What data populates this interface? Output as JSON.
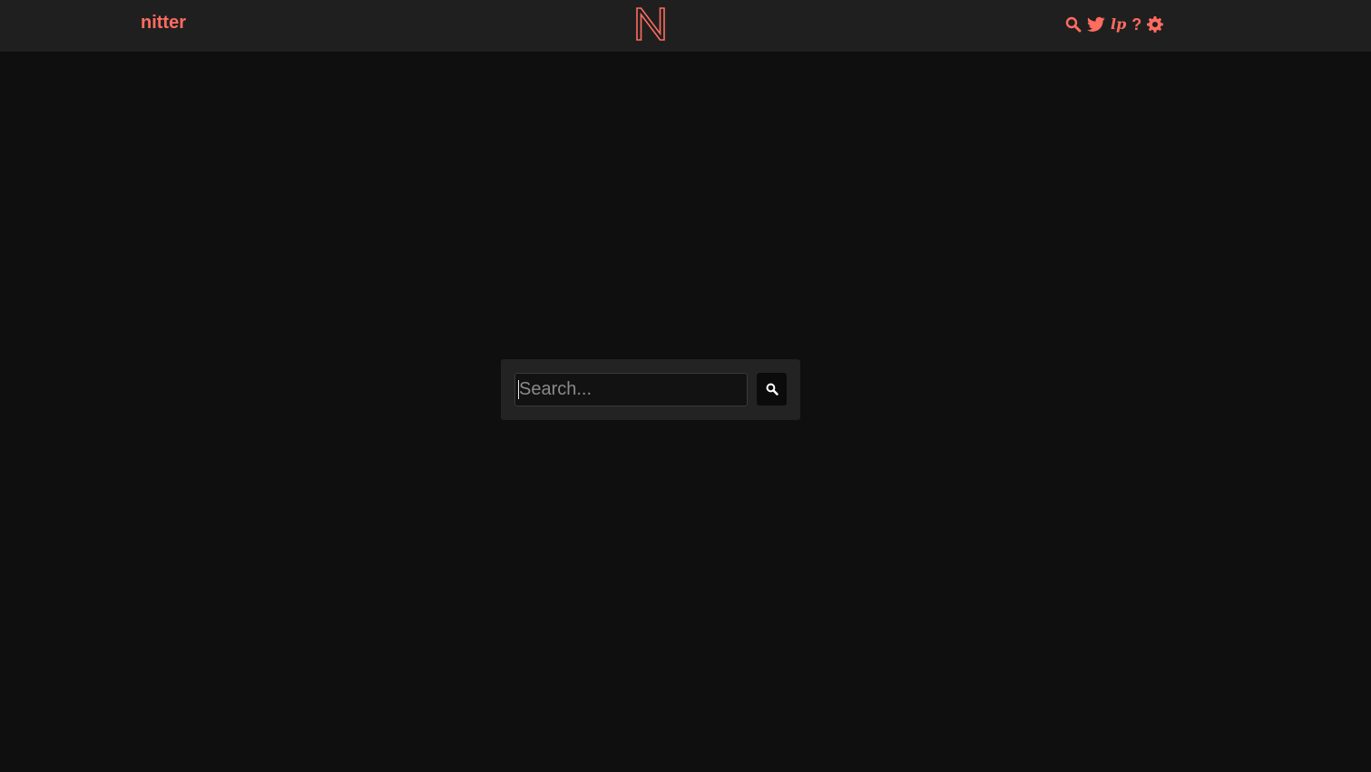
{
  "navbar": {
    "brand": "nitter",
    "icons": [
      {
        "name": "search-icon"
      },
      {
        "name": "twitter-bird-icon"
      },
      {
        "name": "lp-icon",
        "text": "lp"
      },
      {
        "name": "help-icon",
        "text": "?"
      },
      {
        "name": "gear-icon"
      }
    ]
  },
  "search": {
    "placeholder": "Search...",
    "value": "",
    "button_icon": "search-icon"
  },
  "colors": {
    "accent": "#ff6c60",
    "background": "#0f0f0f",
    "navbar": "#1f1f1f",
    "panel": "#232323"
  }
}
